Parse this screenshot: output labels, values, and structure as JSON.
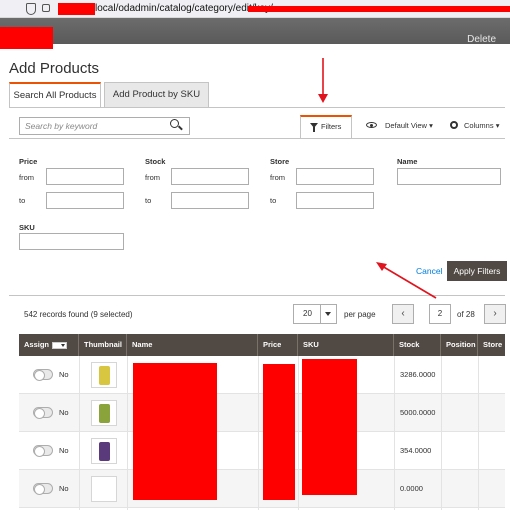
{
  "browser": {
    "url_visible": "local/odadmin/catalog/category/edit/key/"
  },
  "topbar": {
    "delete_label": "Delete"
  },
  "page_title": "Add Products",
  "tabs": [
    {
      "label": "Search All Products"
    },
    {
      "label": "Add Product by SKU"
    }
  ],
  "search": {
    "placeholder": "Search by keyword"
  },
  "toolbar": {
    "filters_label": "Filters",
    "view_label": "Default View",
    "columns_label": "Columns"
  },
  "filters": {
    "price": "Price",
    "stock": "Stock",
    "store": "Store",
    "name": "Name",
    "sku": "SKU",
    "from": "from",
    "to": "to",
    "cancel": "Cancel",
    "apply": "Apply Filters"
  },
  "pager": {
    "records": "542 records found (9 selected)",
    "per_page_value": "20",
    "per_page_label": "per page",
    "current_page": "2",
    "of_pages": "of 28"
  },
  "grid": {
    "columns": [
      "Assign",
      "Thumbnail",
      "Name",
      "Price",
      "SKU",
      "Stock",
      "Position",
      "Store"
    ],
    "rows": [
      {
        "assign": "No",
        "stock": "3286.0000",
        "thumb_color": "#d9c640"
      },
      {
        "assign": "No",
        "stock": "5000.0000",
        "thumb_color": "#8aa33a"
      },
      {
        "assign": "No",
        "stock": "354.0000",
        "thumb_color": "#5a3a7a"
      },
      {
        "assign": "No",
        "stock": "0.0000",
        "thumb_color": ""
      }
    ]
  },
  "colors": {
    "accent": "#eb5202",
    "header_bg": "#514943",
    "link": "#007bdb",
    "annotation": "#e0141e"
  }
}
